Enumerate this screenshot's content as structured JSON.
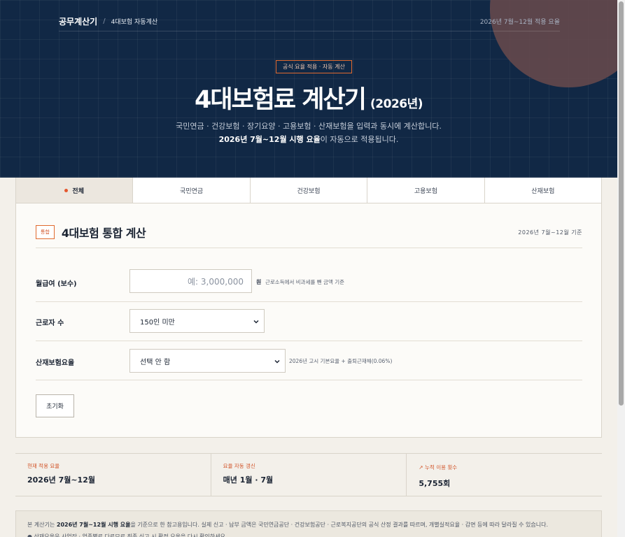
{
  "header": {
    "brand": "공무계산기",
    "breadcrumb_sep": "/",
    "breadcrumb": "4대보험 자동계산",
    "rate_period": "2026년 7월~12월 적용 요율",
    "pill": "공식 요율 적용 · 자동 계산",
    "title": "4대보험료 계산기",
    "title_year": "(2026년)",
    "subtitle": "국민연금 · 건강보험 · 장기요양 · 고용보험 · 산재보험을 입력과 동시에 계산합니다.",
    "subtitle2_bold": "2026년 7월~12월 시행 요율",
    "subtitle2_rest": "이 자동으로 적용됩니다."
  },
  "tabs": [
    {
      "label": "전체",
      "active": true
    },
    {
      "label": "국민연금"
    },
    {
      "label": "건강보험"
    },
    {
      "label": "고용보험"
    },
    {
      "label": "산재보험"
    }
  ],
  "panel": {
    "badge": "통합",
    "title": "4대보험 통합 계산",
    "date": "2026년 7월~12월 기준",
    "salary_label": "월급여 (보수)",
    "salary_placeholder": "예: 3,000,000",
    "salary_unit": "원",
    "salary_hint": "근로소득에서 비과세를 뺀 금액 기준",
    "workers_label": "근로자 수",
    "workers_value": "150인 미만",
    "accident_label": "산재보험요율",
    "accident_value": "선택 안 함",
    "accident_hint": "2026년 고시 기본요율 + 출퇴근재해(0.06%)",
    "reset_label": "초기화"
  },
  "stats": [
    {
      "label": "현재 적용 요율",
      "value": "2026년 7월~12월"
    },
    {
      "label": "요율 자동 갱신",
      "value": "매년 1월 · 7월"
    },
    {
      "label": "↗ 누적 이용 횟수",
      "value": "5,755회"
    }
  ],
  "notice": {
    "line1_pre": "본 계산기는 ",
    "line1_bold": "2026년 7월~12월 시행 요율",
    "line1_post": "을 기준으로 한 참고용입니다. 실제 신고 · 납부 금액은 국민연금공단 · 건강보험공단 · 근로복지공단의 공식 산정 결과를 따르며, 개별실적요율 · 감면 등에 따라 달라질 수 있습니다.",
    "line2": "● 산재요율은 사업장 · 업종별로 다르므로 최종 신고 시 확정 요율을 다시 확인하세요."
  },
  "colors": {
    "navy": "#112845",
    "accent": "#e4572e"
  }
}
